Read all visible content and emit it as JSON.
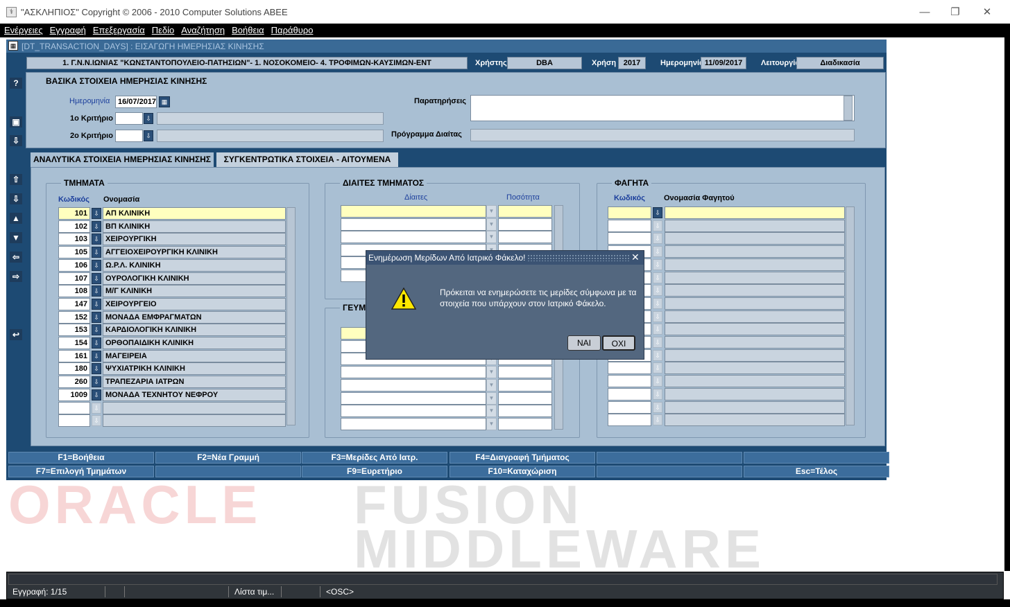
{
  "window": {
    "title": "\"ΑΣΚΛΗΠΙΟΣ\" Copyright © 2006 - 2010 Computer Solutions ABEE",
    "minimize": "—",
    "restore": "❐",
    "close": "✕"
  },
  "menu": [
    "Ενέργειες",
    "Εγγραφή",
    "Επεξεργασία",
    "Πεδίο",
    "Αναζήτηση",
    "Βοήθεια",
    "Παράθυρο"
  ],
  "form": {
    "title": "[DT_TRANSACTION_DAYS]  :  ΕΙΣΑΓΩΓΗ ΗΜΕΡΗΣΙΑΣ ΚΙΝΗΣΗΣ"
  },
  "infobar": {
    "org": "1. Γ.Ν.Ν.ΙΩΝΙΑΣ \"ΚΩΝΣΤΑΝΤΟΠΟΥΛΕΙΟ-ΠΑΤΗΣΙΩΝ\"- 1. ΝΟΣΟΚΟΜΕΙΟ- 4. ΤΡΟΦΙΜΩΝ-ΚΑΥΣΙΜΩΝ-ΕΝΤ",
    "user_label": "Χρήστης",
    "user": "DBA",
    "year_label": "Χρήση",
    "year": "2017",
    "date_label": "Ημερομηνία",
    "date": "11/09/2017",
    "mode_label": "Λειτουργία",
    "mode": "Διαδικασία"
  },
  "basic": {
    "title": "ΒΑΣΙΚΑ ΣΤΟΙΧΕΙΑ ΗΜΕΡΗΣΙΑΣ ΚΙΝΗΣΗΣ",
    "date_label": "Ημερομηνία",
    "date_value": "16/07/2017",
    "crit1_label": "1ο Κριτήριο",
    "crit2_label": "2ο Κριτήριο",
    "notes_label": "Παρατηρήσεις",
    "diet_program_label": "Πρόγραμμα Διαίτας"
  },
  "tabs": [
    "ΑΝΑΛΥΤΙΚΑ ΣΤΟΙΧΕΙΑ ΗΜΕΡΗΣΙΑΣ ΚΙΝΗΣΗΣ",
    "ΣΥΓΚΕΝΤΡΩΤΙΚΑ ΣΤΟΙΧΕΙΑ - ΑΙΤΟΥΜΕΝΑ ΥΛΙΚΑ"
  ],
  "departments": {
    "title": "ΤΜΗΜΑΤΑ",
    "col_code": "Κωδικός",
    "col_name": "Ονομασία",
    "rows": [
      {
        "code": "101",
        "name": "ΑΠ ΚΛΙΝΙΚΗ"
      },
      {
        "code": "102",
        "name": "ΒΠ  ΚΛΙΝΙΚΗ"
      },
      {
        "code": "103",
        "name": "ΧΕΙΡΟΥΡΓΙΚΗ"
      },
      {
        "code": "105",
        "name": "ΑΓΓΕΙΟΧΕΙΡΟΥΡΓΙΚΗ ΚΛΙΝΙΚΗ"
      },
      {
        "code": "106",
        "name": "Ω.Ρ.Λ.  ΚΛΙΝΙΚΗ"
      },
      {
        "code": "107",
        "name": "ΟΥΡΟΛΟΓΙΚΗ ΚΛΙΝΙΚΗ"
      },
      {
        "code": "108",
        "name": "Μ/Γ  ΚΛΙΝΙΚΗ"
      },
      {
        "code": "147",
        "name": "ΧΕΙΡΟΥΡΓΕΙΟ"
      },
      {
        "code": "152",
        "name": "ΜΟΝΑΔΑ ΕΜΦΡΑΓΜΑΤΩΝ"
      },
      {
        "code": "153",
        "name": "ΚΑΡΔΙΟΛΟΓΙΚΗ ΚΛΙΝΙΚΗ"
      },
      {
        "code": "154",
        "name": "ΟΡΘΟΠΑΙΔΙΚΗ ΚΛΙΝΙΚΗ"
      },
      {
        "code": "161",
        "name": "ΜΑΓΕΙΡΕΙΑ"
      },
      {
        "code": "180",
        "name": "ΨΥΧΙΑΤΡΙΚΗ  ΚΛΙΝΙΚΗ"
      },
      {
        "code": "260",
        "name": "ΤΡΑΠΕΖΑΡΙΑ ΙΑΤΡΩΝ"
      },
      {
        "code": "1009",
        "name": "ΜΟΝΑΔΑ ΤΕΧΝΗΤΟΥ ΝΕΦΡΟΥ"
      },
      {
        "code": "",
        "name": ""
      },
      {
        "code": "",
        "name": ""
      }
    ]
  },
  "diets": {
    "title": "ΔΙΑΙΤΕΣ ΤΜΗΜΑΤΟΣ",
    "col_diet": "Δίαιτες",
    "col_qty": "Ποσότητα"
  },
  "meals": {
    "title": "ΓΕΥΜ"
  },
  "foods": {
    "title": "ΦΑΓΗΤΑ",
    "col_code": "Κωδικός",
    "col_name": "Ονομασία Φαγητού"
  },
  "fkeys_row1": [
    "F1=Βοήθεια",
    "F2=Νέα Γραμμή",
    "F3=Μερίδες Από Ιατρ.",
    "F4=Διαγραφή Τμήματος",
    "",
    ""
  ],
  "fkeys_row2": [
    "F7=Επιλογή Τμημάτων",
    "",
    "F9=Ευρετήριο",
    "F10=Καταχώριση",
    "",
    "Esc=Τέλος"
  ],
  "watermark": {
    "w1": "ORACLE",
    "w2": "FUSION",
    "w3": "MIDDLEWARE"
  },
  "status": {
    "record": "Εγγραφή: 1/15",
    "list": "Λίστα τιμ...",
    "osc": "<OSC>"
  },
  "dialog": {
    "title": "Ενημέρωση Μερίδων Από Ιατρικό Φάκελο!",
    "message": "Πρόκειται να ενημερώσετε τις μερίδες σύμφωνα με τα στοιχεία που υπάρχουν στον Ιατρικό Φάκελο.",
    "yes": "ΝΑΙ",
    "no": "ΟΧΙ",
    "close": "✕"
  }
}
